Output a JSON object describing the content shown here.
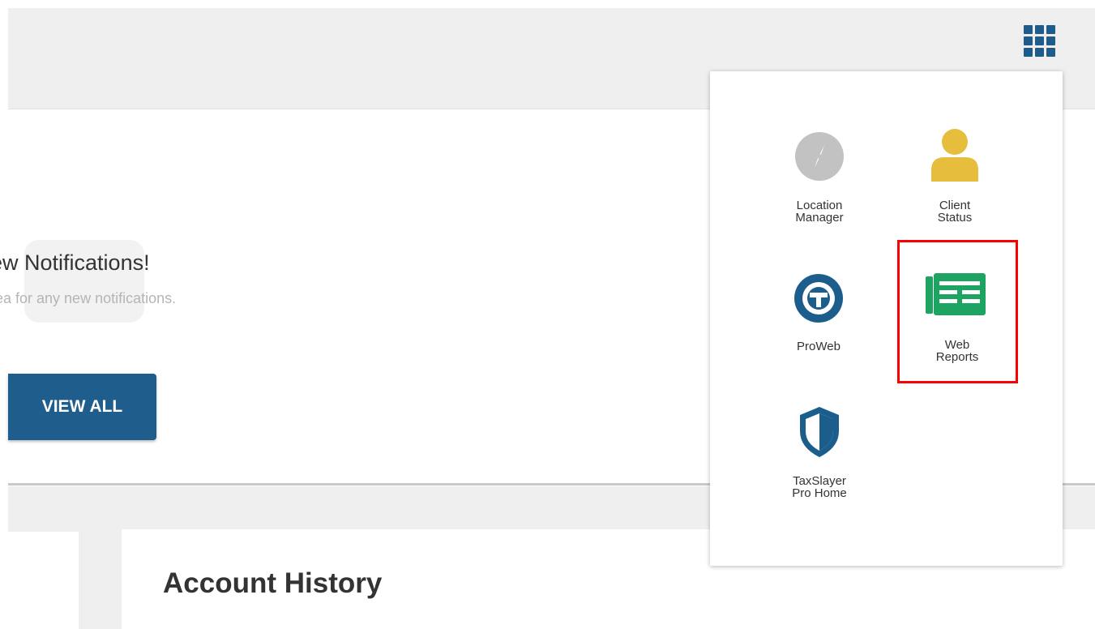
{
  "header": {
    "apps_icon": "grid-icon",
    "apps_icon_color": "#1e5c8c"
  },
  "notifications": {
    "title": "ew Notifications!",
    "subtitle": "rea for any new notifications.",
    "view_all_label": "VIEW ALL",
    "button_color": "#1f5d8c"
  },
  "account_history": {
    "title": "Account History"
  },
  "app_menu": {
    "items": [
      {
        "label": "Location\nManager",
        "icon": "compass-icon",
        "color": "#c2c2c2"
      },
      {
        "label": "Client\nStatus",
        "icon": "person-icon",
        "color": "#e6bd3d"
      },
      {
        "label": "ProWeb",
        "icon": "proweb-icon",
        "color": "#1b5e8c"
      },
      {
        "label": "Web\nReports",
        "icon": "reports-icon",
        "color": "#1da463"
      },
      {
        "label": "TaxSlayer\nPro Home",
        "icon": "shield-icon",
        "color": "#1b5e8c"
      }
    ],
    "highlighted_item": "Web\nReports",
    "highlight_color": "#ff0000"
  }
}
